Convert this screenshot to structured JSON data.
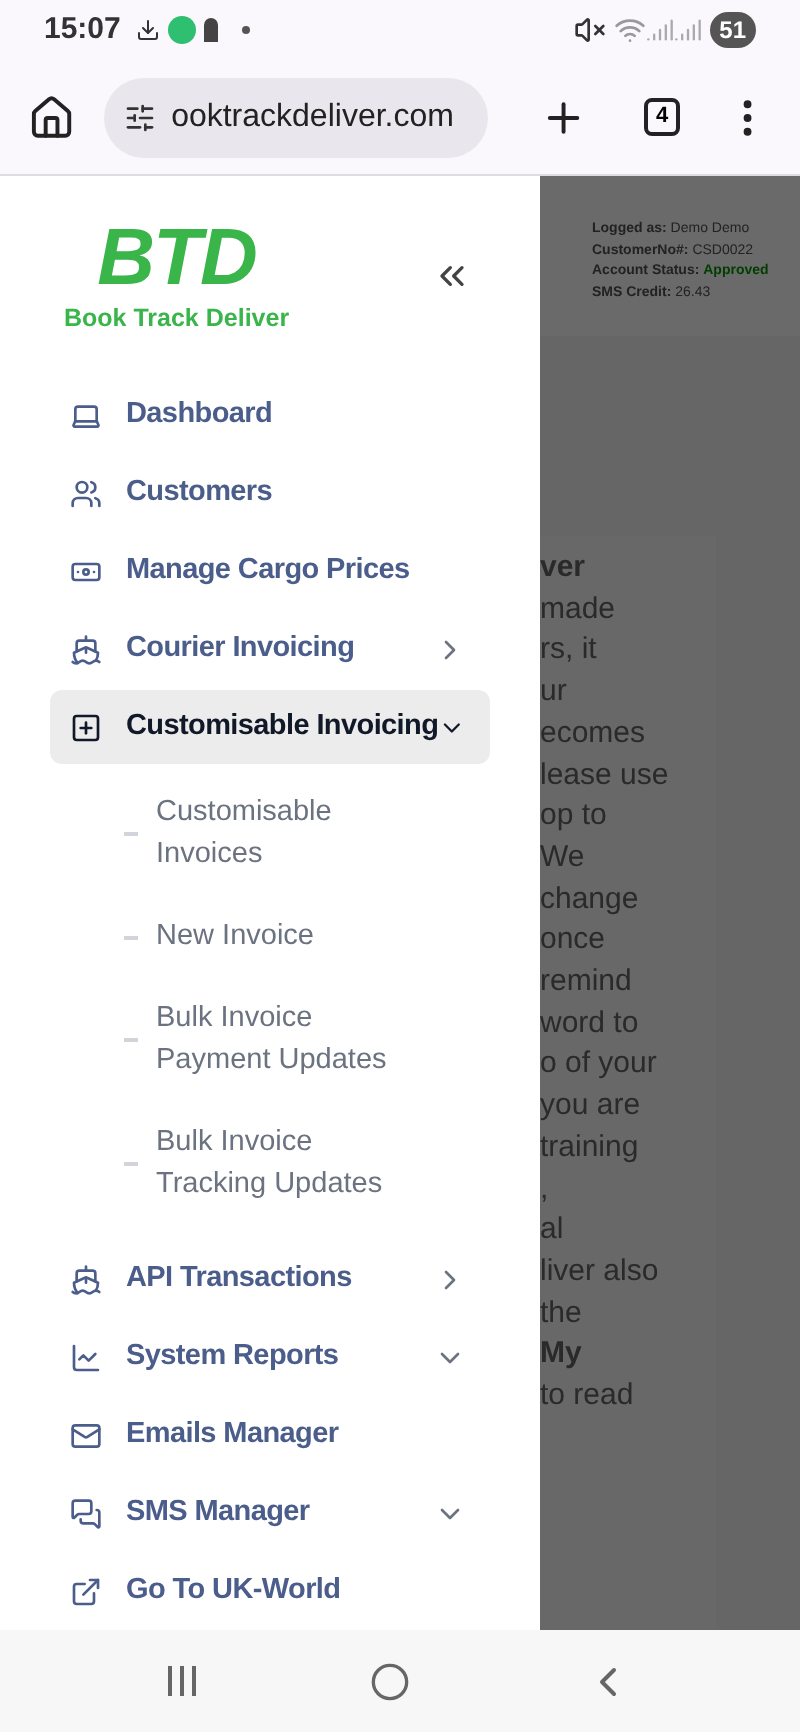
{
  "status_bar": {
    "time": "15:07",
    "battery": "51"
  },
  "browser": {
    "url": "ooktrackdeliver.com",
    "tab_count": "4"
  },
  "logo": {
    "mark": "BTD",
    "name": "Book Track Deliver"
  },
  "account": [
    {
      "label": "Logged as:",
      "value": "Demo Demo",
      "kind": "plain"
    },
    {
      "label": "CustomerNo#:",
      "value": "CSD0022",
      "kind": "plain"
    },
    {
      "label": "Account Status:",
      "value": "Approved",
      "kind": "status"
    },
    {
      "label": "SMS Credit:",
      "value": "26.43",
      "kind": "plain"
    }
  ],
  "menu": [
    {
      "label": "Dashboard",
      "kind": "link",
      "selected": false
    },
    {
      "label": "Customers",
      "kind": "link",
      "selected": false
    },
    {
      "label": "Manage Cargo Prices",
      "kind": "link",
      "selected": false
    },
    {
      "label": "Courier Invoicing",
      "kind": "submenu",
      "selected": false
    },
    {
      "label": "Customisable Invoicing",
      "kind": "dropdown",
      "selected": true,
      "expanded": true,
      "children": [
        {
          "label": "Customisable Invoices"
        },
        {
          "label": "New Invoice"
        },
        {
          "label": "Bulk Invoice Payment Updates"
        },
        {
          "label": "Bulk Invoice Tracking Updates"
        }
      ]
    },
    {
      "label": "API Transactions",
      "kind": "submenu",
      "selected": false
    },
    {
      "label": "System Reports",
      "kind": "dropdown",
      "selected": false,
      "expanded": false
    },
    {
      "label": "Emails Manager",
      "kind": "link",
      "selected": false
    },
    {
      "label": "SMS Manager",
      "kind": "dropdown",
      "selected": false,
      "expanded": false
    },
    {
      "label": "Go To UK-World",
      "kind": "link",
      "selected": false
    }
  ],
  "background_text": [
    {
      "text": "ver",
      "bold": true
    },
    {
      "text": "made",
      "bold": false
    },
    {
      "text": "rs, it",
      "bold": false
    },
    {
      "text": "ur",
      "bold": false
    },
    {
      "text": "ecomes",
      "bold": false
    },
    {
      "text": "lease use",
      "bold": false
    },
    {
      "text": "op to",
      "bold": false
    },
    {
      "text": "We",
      "bold": false
    },
    {
      "text": "change",
      "bold": false
    },
    {
      "text": "once",
      "bold": false
    },
    {
      "text": "remind",
      "bold": false
    },
    {
      "text": "word to",
      "bold": false
    },
    {
      "text": "o of your",
      "bold": false
    },
    {
      "text": "you are",
      "bold": false
    },
    {
      "text": "training",
      "bold": false
    },
    {
      "text": ",",
      "bold": false
    },
    {
      "text": "al",
      "bold": false
    },
    {
      "text": "liver also",
      "bold": false
    },
    {
      "text": "the",
      "bold": false
    },
    {
      "text": "My",
      "bold": true
    },
    {
      "text": "to read",
      "bold": false
    }
  ]
}
